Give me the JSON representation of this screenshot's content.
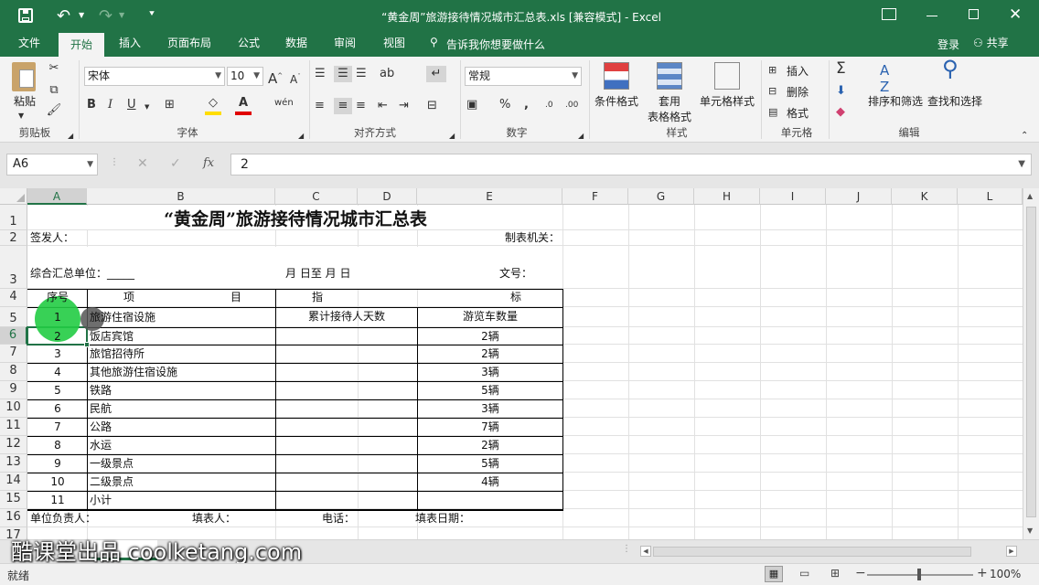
{
  "titlebar": {
    "doc_title": "“黄金周”旅游接待情况城市汇总表.xls  [兼容模式] - Excel"
  },
  "tabs": [
    "文件",
    "开始",
    "插入",
    "页面布局",
    "公式",
    "数据",
    "审阅",
    "视图"
  ],
  "tell_me": "告诉我你想要做什么",
  "login": "登录",
  "share": "共享",
  "ribbon": {
    "paste": "粘贴",
    "clipboard": "剪贴板",
    "font_name": "宋体",
    "font_size": "10",
    "font_group": "字体",
    "align_group": "对齐方式",
    "number_format": "常规",
    "number_group": "数字",
    "cond_format": "条件格式",
    "table_format_1": "套用",
    "table_format_2": "表格格式",
    "cell_style": "单元格样式",
    "styles_group": "样式",
    "insert": "插入",
    "delete": "删除",
    "format": "格式",
    "cells_group": "单元格",
    "sort_filter": "排序和筛选",
    "find_select": "查找和选择",
    "edit_group": "编辑"
  },
  "formula": {
    "namebox": "A6",
    "value": "2",
    "fx": "fx"
  },
  "columns": [
    "A",
    "B",
    "C",
    "D",
    "E",
    "F",
    "G",
    "H",
    "I",
    "J",
    "K",
    "L"
  ],
  "rows": [
    "1",
    "2",
    "3",
    "4",
    "5",
    "6",
    "7",
    "8",
    "9",
    "10",
    "11",
    "12",
    "13",
    "14",
    "15",
    "16",
    "17"
  ],
  "sheet": {
    "title": "“黄金周”旅游接待情况城市汇总表",
    "issuer": "签发人：",
    "org": "制表机关：",
    "unit": "综合汇总单位：_____",
    "date_range": "月  日至  月  日",
    "doc_no": "文号：",
    "h_seq": "序号",
    "h_item1": "项",
    "h_item2": "目",
    "h_ind1": "指",
    "h_ind2": "标",
    "h_days": "累计接待人天数",
    "h_cars": "游览车数量",
    "items": [
      {
        "seq": "1",
        "name": "旅游住宿设施",
        "cars": ""
      },
      {
        "seq": "2",
        "name": "饭店宾馆",
        "cars": "2辆"
      },
      {
        "seq": "3",
        "name": "旅馆招待所",
        "cars": "2辆"
      },
      {
        "seq": "4",
        "name": "其他旅游住宿设施",
        "cars": "3辆"
      },
      {
        "seq": "5",
        "name": "铁路",
        "cars": "5辆"
      },
      {
        "seq": "6",
        "name": "民航",
        "cars": "3辆"
      },
      {
        "seq": "7",
        "name": "公路",
        "cars": "7辆"
      },
      {
        "seq": "8",
        "name": "水运",
        "cars": "2辆"
      },
      {
        "seq": "9",
        "name": "一级景点",
        "cars": "5辆"
      },
      {
        "seq": "10",
        "name": "二级景点",
        "cars": "4辆"
      },
      {
        "seq": "11",
        "name": "小计",
        "cars": ""
      }
    ],
    "footer_head": "单位负责人：",
    "footer_filler": "填表人：",
    "footer_phone": "电话：",
    "footer_date": "填表日期："
  },
  "watermark": "酷课堂出品 coolketang.com",
  "status": {
    "ready": "就绪",
    "zoom": "100%"
  },
  "colors": {
    "accent": "#217346",
    "click_marker": "#22cc44"
  }
}
